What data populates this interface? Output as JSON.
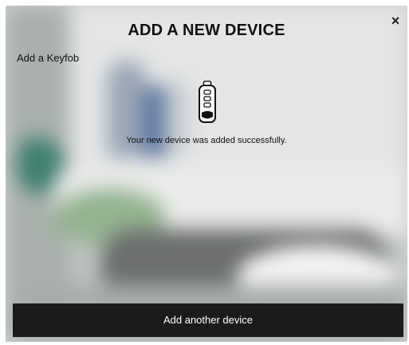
{
  "dialog": {
    "title": "ADD A NEW DEVICE",
    "close_glyph": "×",
    "subtitle": "Add a Keyfob",
    "device_icon": "keyfob-icon",
    "success_message": "Your new device was added successfully.",
    "add_another_label": "Add another device"
  }
}
